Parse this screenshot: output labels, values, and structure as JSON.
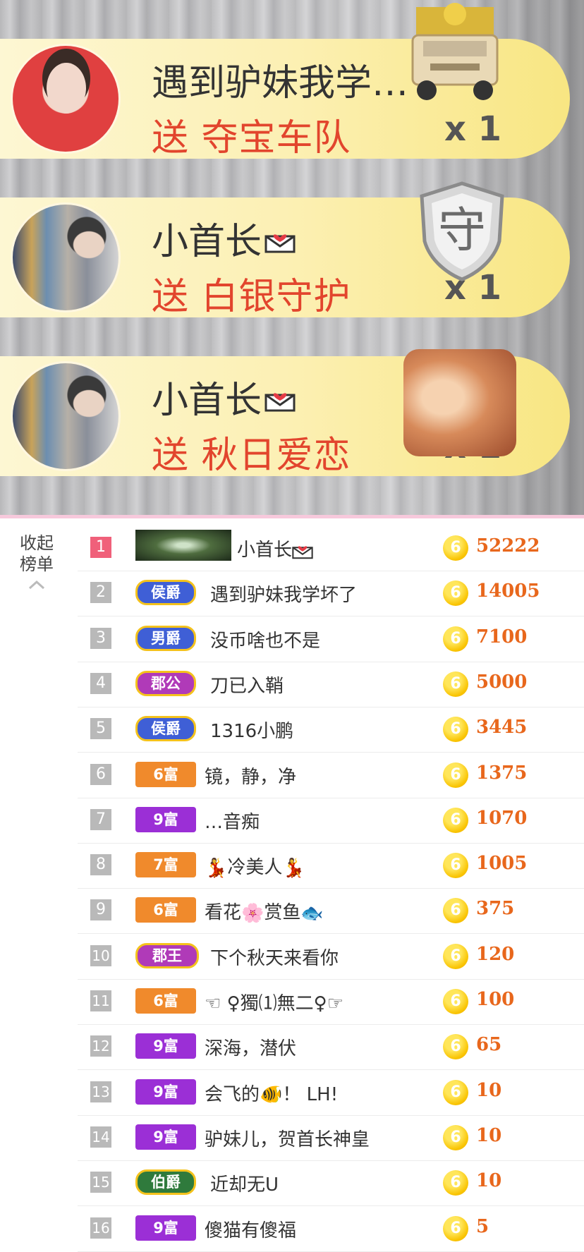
{
  "gift_feed": [
    {
      "user": "遇到驴妹我学…",
      "send_text": "送 夺宝车队",
      "count": "x 1",
      "avatar": "female-avatar",
      "gift_icon": "armored-car-icon"
    },
    {
      "user": "小首长",
      "send_text": "送 白银守护",
      "count": "x 1",
      "avatar": "male-avatar",
      "gift_icon": "silver-shield-icon",
      "shield_char": "守"
    },
    {
      "user": "小首长",
      "send_text": "送 秋日爱恋",
      "count": "x 1",
      "avatar": "male-avatar",
      "gift_icon": "autumn-love-art-icon"
    }
  ],
  "board": {
    "collapse_label_1": "收起",
    "collapse_label_2": "榜单",
    "rows": [
      {
        "rank": "1",
        "badge": "",
        "badge_type": "banner",
        "name": "小首长",
        "amount": "52222"
      },
      {
        "rank": "2",
        "badge": "侯爵",
        "badge_type": "duke-blue",
        "name": "遇到驴妹我学坏了",
        "amount": "14005"
      },
      {
        "rank": "3",
        "badge": "男爵",
        "badge_type": "duke-blue",
        "name": "没币啥也不是",
        "amount": "7100"
      },
      {
        "rank": "4",
        "badge": "郡公",
        "badge_type": "duke-purple",
        "name": "刀已入鞘",
        "amount": "5000"
      },
      {
        "rank": "5",
        "badge": "侯爵",
        "badge_type": "duke-blue",
        "name": "1316小鹏",
        "amount": "3445"
      },
      {
        "rank": "6",
        "badge": "6富",
        "badge_type": "fu-orange",
        "name": "镜，静，净",
        "amount": "1375"
      },
      {
        "rank": "7",
        "badge": "9富",
        "badge_type": "fu-purple",
        "name": "…音痴",
        "amount": "1070"
      },
      {
        "rank": "8",
        "badge": "7富",
        "badge_type": "fu-orange",
        "name": "冷美人",
        "amount": "1005"
      },
      {
        "rank": "9",
        "badge": "6富",
        "badge_type": "fu-orange",
        "name": "看花",
        "name2": "赏鱼",
        "amount": "375"
      },
      {
        "rank": "10",
        "badge": "郡王",
        "badge_type": "king",
        "name": "下个秋天来看你",
        "amount": "120"
      },
      {
        "rank": "11",
        "badge": "6富",
        "badge_type": "fu-orange",
        "name": "☜ ♀獨⑴無二♀☞",
        "amount": "100"
      },
      {
        "rank": "12",
        "badge": "9富",
        "badge_type": "fu-purple",
        "name": "深海，潜伏",
        "amount": "65"
      },
      {
        "rank": "13",
        "badge": "9富",
        "badge_type": "fu-purple",
        "name": "会飞的",
        "name2": "！ LH!",
        "amount": "10"
      },
      {
        "rank": "14",
        "badge": "9富",
        "badge_type": "fu-purple",
        "name": "驴妹儿，贺首长神皇",
        "amount": "10"
      },
      {
        "rank": "15",
        "badge": "伯爵",
        "badge_type": "duke-green",
        "name": "近却无U",
        "amount": "10"
      },
      {
        "rank": "16",
        "badge": "9富",
        "badge_type": "fu-purple",
        "name": "傻猫有傻福",
        "amount": "5"
      }
    ],
    "coin_symbol": "6"
  },
  "colors": {
    "send_red": "#e2452d",
    "amount_orange": "#e8671c",
    "rank_first": "#f0607a",
    "fu_orange": "#f08a2c",
    "fu_purple": "#9b2fd6",
    "duke_blue": "#3f5fd6",
    "duke_purple": "#b03ab8",
    "duke_green": "#2f7a3c"
  }
}
